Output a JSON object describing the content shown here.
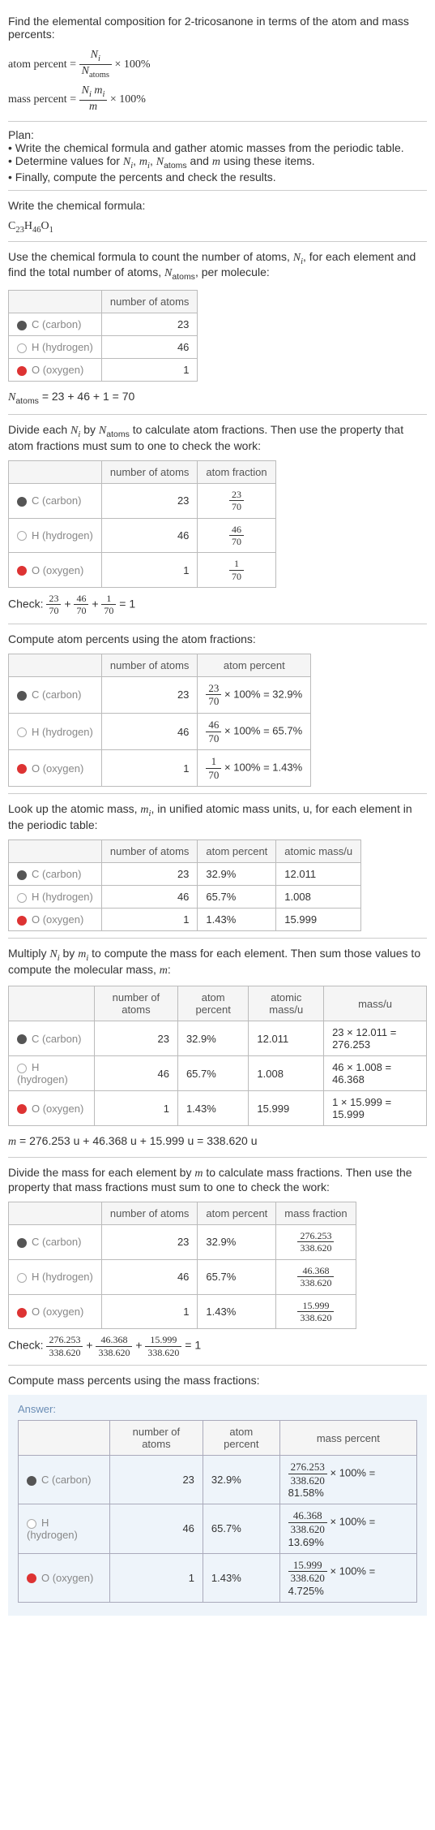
{
  "intro": {
    "line1": "Find the elemental composition for 2-tricosanone in terms of the atom and mass percents:",
    "atom_pct_label": "atom percent = ",
    "atom_pct_num": "N_i",
    "atom_pct_den": "N_atoms",
    "times100": " × 100%",
    "mass_pct_label": "mass percent = ",
    "mass_pct_num": "N_i m_i",
    "mass_pct_den": "m"
  },
  "plan": {
    "heading": "Plan:",
    "b1": "• Write the chemical formula and gather atomic masses from the periodic table.",
    "b2_pre": "• Determine values for ",
    "b2_post": " using these items.",
    "b3": "• Finally, compute the percents and check the results."
  },
  "step_write": {
    "heading": "Write the chemical formula:",
    "formula_c": "C",
    "formula_c_sub": "23",
    "formula_h": "H",
    "formula_h_sub": "46",
    "formula_o": "O",
    "formula_o_sub": "1"
  },
  "count": {
    "para_pre": "Use the chemical formula to count the number of atoms, ",
    "para_mid": ", for each element and find the total number of atoms, ",
    "para_post": ", per molecule:",
    "hdr1": "",
    "hdr2": "number of atoms",
    "c_label": "C (carbon)",
    "c_n": "23",
    "h_label": "H (hydrogen)",
    "h_n": "46",
    "o_label": "O (oxygen)",
    "o_n": "1",
    "sum": " = 23 + 46 + 1 = 70"
  },
  "fractions": {
    "para_pre": "Divide each ",
    "para_mid": " by ",
    "para_mid2": " to calculate atom fractions. Then use the property that atom fractions must sum to one to check the work:",
    "hdr2": "number of atoms",
    "hdr3": "atom fraction",
    "c_frac_num": "23",
    "c_frac_den": "70",
    "h_frac_num": "46",
    "h_frac_den": "70",
    "o_frac_num": "1",
    "o_frac_den": "70",
    "check_label": "Check: ",
    "check_eq": " = 1"
  },
  "atom_pct": {
    "para": "Compute atom percents using the atom fractions:",
    "hdr2": "number of atoms",
    "hdr3": "atom percent",
    "c_eq": " × 100% = 32.9%",
    "h_eq": " × 100% = 65.7%",
    "o_eq": " × 100% = 1.43%"
  },
  "mass_lookup": {
    "para_pre": "Look up the atomic mass, ",
    "para_post": ", in unified atomic mass units, u, for each element in the periodic table:",
    "hdr2": "number of atoms",
    "hdr3": "atom percent",
    "hdr4": "atomic mass/u",
    "c_pct": "32.9%",
    "c_mass": "12.011",
    "h_pct": "65.7%",
    "h_mass": "1.008",
    "o_pct": "1.43%",
    "o_mass": "15.999"
  },
  "mass_mult": {
    "para_pre": "Multiply ",
    "para_mid": " by ",
    "para_mid2": " to compute the mass for each element. Then sum those values to compute the molecular mass, ",
    "para_post": ":",
    "hdr5": "mass/u",
    "c_calc": "23 × 12.011 = 276.253",
    "h_calc": "46 × 1.008 = 46.368",
    "o_calc": "1 × 15.999 = 15.999",
    "m_eq": " = 276.253 u + 46.368 u + 15.999 u = 338.620 u"
  },
  "mass_frac": {
    "para": "Divide the mass for each element by m to calculate mass fractions. Then use the property that mass fractions must sum to one to check the work:",
    "para_pre": "Divide the mass for each element by ",
    "para_post": " to calculate mass fractions. Then use the property that mass fractions must sum to one to check the work:",
    "hdr4": "mass fraction",
    "c_num": "276.253",
    "c_den": "338.620",
    "h_num": "46.368",
    "h_den": "338.620",
    "o_num": "15.999",
    "o_den": "338.620",
    "check_eq": " = 1"
  },
  "final": {
    "para": "Compute mass percents using the mass fractions:",
    "answer_label": "Answer:",
    "hdr2": "number of atoms",
    "hdr3": "atom percent",
    "hdr4": "mass percent",
    "c_eq": " × 100% = 81.58%",
    "h_eq": " × 100% = 13.69%",
    "o_eq": " × 100% = 4.725%"
  }
}
